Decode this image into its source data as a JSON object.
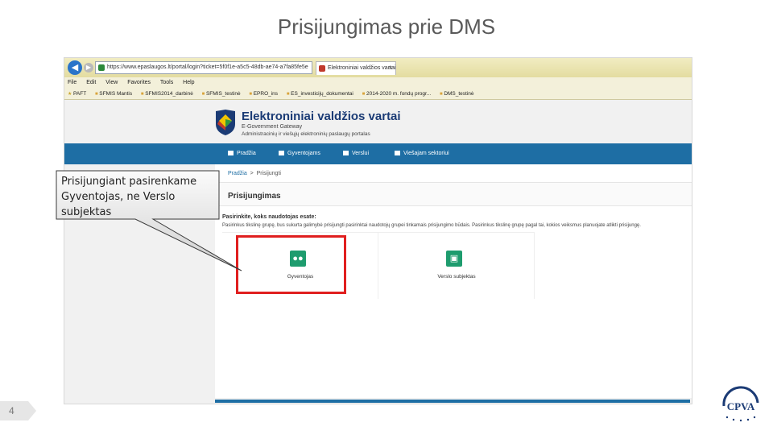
{
  "slide": {
    "title": "Prisijungimas prie DMS",
    "page_number": "4",
    "corner_logo_text": "CPVA"
  },
  "callout": {
    "line1": "Prisijungiant pasirenkame",
    "line2": "Gyventojas, ne Verslo",
    "line3": "subjektas"
  },
  "browser": {
    "address": "https://www.epaslaugos.lt/portal/login?ticket=5f0f1e-a5c5-48db-ae74-a7fa85fe5e",
    "tab_label": "Elektroniniai valdžios vartai",
    "tab_close": "×",
    "menu": [
      "File",
      "Edit",
      "View",
      "Favorites",
      "Tools",
      "Help"
    ],
    "favorites": [
      "PAFT",
      "SFMIS Mantis",
      "SFMIS2014_darbinė",
      "SFMIS_testinė",
      "EPRO_ins",
      "ES_investicijų_dokumentai",
      "2014-2020 m. fondų progr...",
      "DMS_testinė"
    ]
  },
  "site": {
    "title": "Elektroniniai valdžios vartai",
    "subtitle": "E-Government Gateway",
    "tagline": "Administracinių ir viešųjų elektroninių paslaugų portalas",
    "nav": [
      "Pradžia",
      "Gyventojams",
      "Verslui",
      "Viešajam sektoriui"
    ],
    "breadcrumb": {
      "home": "Pradžia",
      "separator": ">",
      "current": "Prisijungti"
    },
    "section_title": "Prisijungimas",
    "choose_title": "Pasirinkite, koks naudotojas esate:",
    "choose_desc": "Pasirinkus tikslinę grupę, bus sukurta galimybė prisijungti pasirinktai naudotojų grupei tinkamais prisijungimo būdais. Pasirinkus tikslinę grupę pagal tai, kokios veiksmus planuojate atlikti prisijungę.",
    "cards": [
      {
        "label": "Gyventojas",
        "icon": "people-icon"
      },
      {
        "label": "Verslo subjektas",
        "icon": "briefcase-icon"
      }
    ]
  },
  "colors": {
    "nav_blue": "#1e6ea4",
    "card_green": "#1e9c6e",
    "highlight_red": "#e01f1f",
    "title_navy": "#1b3b75"
  }
}
